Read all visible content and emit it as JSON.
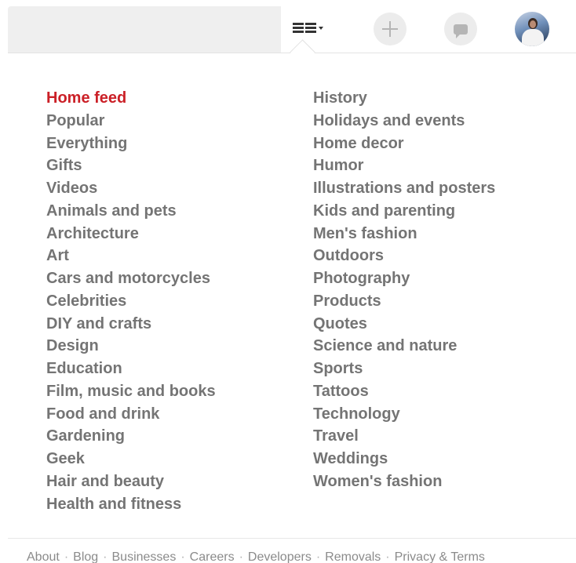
{
  "header": {
    "search_placeholder": "",
    "icons": {
      "menu": "category-menu-icon",
      "add": "plus-icon",
      "messages": "chat-bubble-icon",
      "profile": "avatar"
    }
  },
  "categories": {
    "left": [
      "Home feed",
      "Popular",
      "Everything",
      "Gifts",
      "Videos",
      "Animals and pets",
      "Architecture",
      "Art",
      "Cars and motorcycles",
      "Celebrities",
      "DIY and crafts",
      "Design",
      "Education",
      "Film, music and books",
      "Food and drink",
      "Gardening",
      "Geek",
      "Hair and beauty",
      "Health and fitness"
    ],
    "right": [
      "History",
      "Holidays and events",
      "Home decor",
      "Humor",
      "Illustrations and posters",
      "Kids and parenting",
      "Men's fashion",
      "Outdoors",
      "Photography",
      "Products",
      "Quotes",
      "Science and nature",
      "Sports",
      "Tattoos",
      "Technology",
      "Travel",
      "Weddings",
      "Women's fashion"
    ],
    "active": "Home feed"
  },
  "footer": {
    "links": [
      "About",
      "Blog",
      "Businesses",
      "Careers",
      "Developers",
      "Removals",
      "Privacy & Terms"
    ],
    "separator": "·"
  },
  "colors": {
    "active": "#cb2027",
    "text": "#747474",
    "footer": "#8b8b8b"
  }
}
